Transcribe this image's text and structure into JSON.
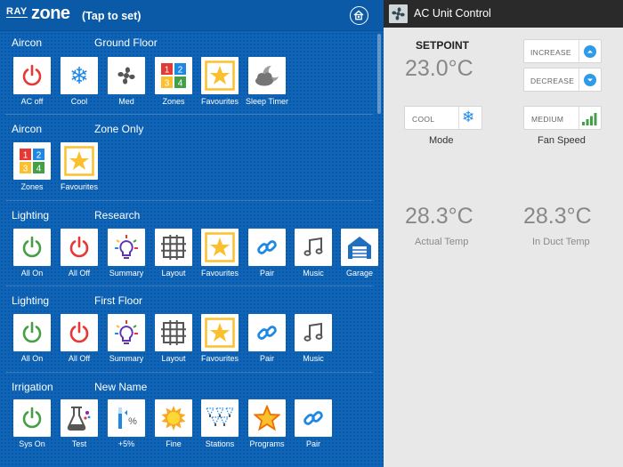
{
  "header": {
    "logo_ray": "RAY",
    "logo_zone": "zone",
    "tap_hint": "(Tap to set)"
  },
  "sections": [
    {
      "title": "Aircon",
      "subtitle": "Ground Floor",
      "tiles": [
        {
          "label": "AC off",
          "icon": "power-red-icon"
        },
        {
          "label": "Cool",
          "icon": "snowflake-icon"
        },
        {
          "label": "Med",
          "icon": "fan-icon"
        },
        {
          "label": "Zones",
          "icon": "zones-grid-icon"
        },
        {
          "label": "Favourites",
          "icon": "star-icon"
        },
        {
          "label": "Sleep Timer",
          "icon": "moon-cloud-icon"
        }
      ]
    },
    {
      "title": "Aircon",
      "subtitle": "Zone Only",
      "tiles": [
        {
          "label": "Zones",
          "icon": "zones-grid-icon"
        },
        {
          "label": "Favourites",
          "icon": "star-icon"
        }
      ]
    },
    {
      "title": "Lighting",
      "subtitle": "Research",
      "tiles": [
        {
          "label": "All On",
          "icon": "power-green-icon"
        },
        {
          "label": "All Off",
          "icon": "power-red-icon"
        },
        {
          "label": "Summary",
          "icon": "bulb-icon"
        },
        {
          "label": "Layout",
          "icon": "grid-layout-icon"
        },
        {
          "label": "Favourites",
          "icon": "star-icon"
        },
        {
          "label": "Pair",
          "icon": "link-icon"
        },
        {
          "label": "Music",
          "icon": "music-icon"
        },
        {
          "label": "Garage",
          "icon": "garage-icon"
        }
      ]
    },
    {
      "title": "Lighting",
      "subtitle": "First Floor",
      "tiles": [
        {
          "label": "All On",
          "icon": "power-green-icon"
        },
        {
          "label": "All Off",
          "icon": "power-red-icon"
        },
        {
          "label": "Summary",
          "icon": "bulb-icon"
        },
        {
          "label": "Layout",
          "icon": "grid-layout-icon"
        },
        {
          "label": "Favourites",
          "icon": "star-icon"
        },
        {
          "label": "Pair",
          "icon": "link-icon"
        },
        {
          "label": "Music",
          "icon": "music-icon"
        }
      ]
    },
    {
      "title": "Irrigation",
      "subtitle": "New Name",
      "tiles": [
        {
          "label": "Sys On",
          "icon": "power-green-icon"
        },
        {
          "label": "Test",
          "icon": "flask-icon"
        },
        {
          "label": "+5%",
          "icon": "percent-gauge-icon"
        },
        {
          "label": "Fine",
          "icon": "sun-icon"
        },
        {
          "label": "Stations",
          "icon": "sprinkler-icon"
        },
        {
          "label": "Programs",
          "icon": "star-orange-icon"
        },
        {
          "label": "Pair",
          "icon": "link-icon"
        }
      ]
    }
  ],
  "ac": {
    "title": "AC Unit Control",
    "setpoint_label": "SETPOINT",
    "setpoint": "23.0°C",
    "increase": "INCREASE",
    "decrease": "DECREASE",
    "mode_value": "COOL",
    "mode_label": "Mode",
    "fan_value": "MEDIUM",
    "fan_label": "Fan Speed",
    "actual_temp": "28.3°C",
    "actual_label": "Actual Temp",
    "duct_temp": "28.3°C",
    "duct_label": "In Duct Temp"
  },
  "colors": {
    "accent_blue": "#0e64b8",
    "power_red": "#e53935",
    "power_green": "#43a047",
    "star_yellow": "#fbc02d"
  }
}
